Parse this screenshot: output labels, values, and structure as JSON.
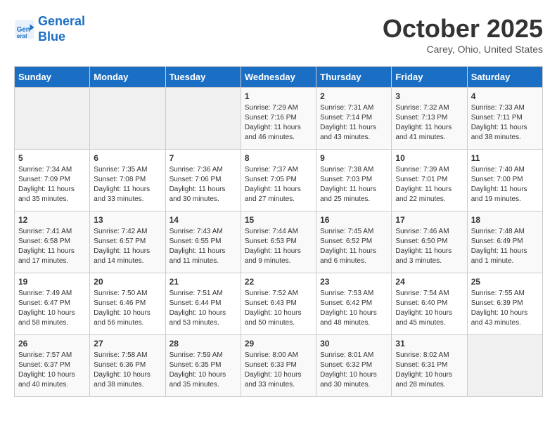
{
  "header": {
    "logo_line1": "General",
    "logo_line2": "Blue",
    "month_title": "October 2025",
    "location": "Carey, Ohio, United States"
  },
  "days_of_week": [
    "Sunday",
    "Monday",
    "Tuesday",
    "Wednesday",
    "Thursday",
    "Friday",
    "Saturday"
  ],
  "weeks": [
    [
      {
        "day": "",
        "info": ""
      },
      {
        "day": "",
        "info": ""
      },
      {
        "day": "",
        "info": ""
      },
      {
        "day": "1",
        "info": "Sunrise: 7:29 AM\nSunset: 7:16 PM\nDaylight: 11 hours and 46 minutes."
      },
      {
        "day": "2",
        "info": "Sunrise: 7:31 AM\nSunset: 7:14 PM\nDaylight: 11 hours and 43 minutes."
      },
      {
        "day": "3",
        "info": "Sunrise: 7:32 AM\nSunset: 7:13 PM\nDaylight: 11 hours and 41 minutes."
      },
      {
        "day": "4",
        "info": "Sunrise: 7:33 AM\nSunset: 7:11 PM\nDaylight: 11 hours and 38 minutes."
      }
    ],
    [
      {
        "day": "5",
        "info": "Sunrise: 7:34 AM\nSunset: 7:09 PM\nDaylight: 11 hours and 35 minutes."
      },
      {
        "day": "6",
        "info": "Sunrise: 7:35 AM\nSunset: 7:08 PM\nDaylight: 11 hours and 33 minutes."
      },
      {
        "day": "7",
        "info": "Sunrise: 7:36 AM\nSunset: 7:06 PM\nDaylight: 11 hours and 30 minutes."
      },
      {
        "day": "8",
        "info": "Sunrise: 7:37 AM\nSunset: 7:05 PM\nDaylight: 11 hours and 27 minutes."
      },
      {
        "day": "9",
        "info": "Sunrise: 7:38 AM\nSunset: 7:03 PM\nDaylight: 11 hours and 25 minutes."
      },
      {
        "day": "10",
        "info": "Sunrise: 7:39 AM\nSunset: 7:01 PM\nDaylight: 11 hours and 22 minutes."
      },
      {
        "day": "11",
        "info": "Sunrise: 7:40 AM\nSunset: 7:00 PM\nDaylight: 11 hours and 19 minutes."
      }
    ],
    [
      {
        "day": "12",
        "info": "Sunrise: 7:41 AM\nSunset: 6:58 PM\nDaylight: 11 hours and 17 minutes."
      },
      {
        "day": "13",
        "info": "Sunrise: 7:42 AM\nSunset: 6:57 PM\nDaylight: 11 hours and 14 minutes."
      },
      {
        "day": "14",
        "info": "Sunrise: 7:43 AM\nSunset: 6:55 PM\nDaylight: 11 hours and 11 minutes."
      },
      {
        "day": "15",
        "info": "Sunrise: 7:44 AM\nSunset: 6:53 PM\nDaylight: 11 hours and 9 minutes."
      },
      {
        "day": "16",
        "info": "Sunrise: 7:45 AM\nSunset: 6:52 PM\nDaylight: 11 hours and 6 minutes."
      },
      {
        "day": "17",
        "info": "Sunrise: 7:46 AM\nSunset: 6:50 PM\nDaylight: 11 hours and 3 minutes."
      },
      {
        "day": "18",
        "info": "Sunrise: 7:48 AM\nSunset: 6:49 PM\nDaylight: 11 hours and 1 minute."
      }
    ],
    [
      {
        "day": "19",
        "info": "Sunrise: 7:49 AM\nSunset: 6:47 PM\nDaylight: 10 hours and 58 minutes."
      },
      {
        "day": "20",
        "info": "Sunrise: 7:50 AM\nSunset: 6:46 PM\nDaylight: 10 hours and 56 minutes."
      },
      {
        "day": "21",
        "info": "Sunrise: 7:51 AM\nSunset: 6:44 PM\nDaylight: 10 hours and 53 minutes."
      },
      {
        "day": "22",
        "info": "Sunrise: 7:52 AM\nSunset: 6:43 PM\nDaylight: 10 hours and 50 minutes."
      },
      {
        "day": "23",
        "info": "Sunrise: 7:53 AM\nSunset: 6:42 PM\nDaylight: 10 hours and 48 minutes."
      },
      {
        "day": "24",
        "info": "Sunrise: 7:54 AM\nSunset: 6:40 PM\nDaylight: 10 hours and 45 minutes."
      },
      {
        "day": "25",
        "info": "Sunrise: 7:55 AM\nSunset: 6:39 PM\nDaylight: 10 hours and 43 minutes."
      }
    ],
    [
      {
        "day": "26",
        "info": "Sunrise: 7:57 AM\nSunset: 6:37 PM\nDaylight: 10 hours and 40 minutes."
      },
      {
        "day": "27",
        "info": "Sunrise: 7:58 AM\nSunset: 6:36 PM\nDaylight: 10 hours and 38 minutes."
      },
      {
        "day": "28",
        "info": "Sunrise: 7:59 AM\nSunset: 6:35 PM\nDaylight: 10 hours and 35 minutes."
      },
      {
        "day": "29",
        "info": "Sunrise: 8:00 AM\nSunset: 6:33 PM\nDaylight: 10 hours and 33 minutes."
      },
      {
        "day": "30",
        "info": "Sunrise: 8:01 AM\nSunset: 6:32 PM\nDaylight: 10 hours and 30 minutes."
      },
      {
        "day": "31",
        "info": "Sunrise: 8:02 AM\nSunset: 6:31 PM\nDaylight: 10 hours and 28 minutes."
      },
      {
        "day": "",
        "info": ""
      }
    ]
  ]
}
